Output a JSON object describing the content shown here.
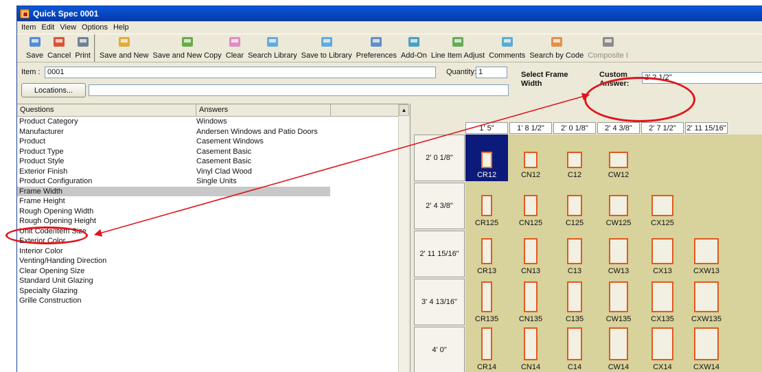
{
  "window": {
    "title": "Quick Spec 0001"
  },
  "menu": [
    "Item",
    "Edit",
    "View",
    "Options",
    "Help"
  ],
  "toolbar": {
    "group1": [
      {
        "label": "Save",
        "icon": "save-icon"
      },
      {
        "label": "Cancel",
        "icon": "cancel-icon"
      },
      {
        "label": "Print",
        "icon": "print-icon"
      }
    ],
    "group2": [
      {
        "label": "Save and New",
        "icon": "save-and-new-icon"
      },
      {
        "label": "Save and New Copy",
        "icon": "save-and-new-copy-icon"
      },
      {
        "label": "Clear",
        "icon": "clear-icon"
      },
      {
        "label": "Search Library",
        "icon": "search-library-icon"
      },
      {
        "label": "Save to Library",
        "icon": "save-to-library-icon"
      },
      {
        "label": "Preferences",
        "icon": "preferences-icon"
      },
      {
        "label": "Add-On",
        "icon": "add-on-icon"
      },
      {
        "label": "Line Item Adjust",
        "icon": "line-item-adjust-icon"
      },
      {
        "label": "Comments",
        "icon": "comments-icon"
      },
      {
        "label": "Search by Code",
        "icon": "search-by-code-icon"
      },
      {
        "label": "Composite I",
        "icon": "composite-icon",
        "disabled": true
      }
    ]
  },
  "item": {
    "label": "Item :",
    "value": "0001",
    "quantity_label": "Quantity:",
    "quantity_value": "1",
    "locations_button": "Locations...",
    "locations_value": ""
  },
  "select_frame": {
    "label_line1": "Select Frame",
    "label_line2": "Width",
    "custom_label_line1": "Custom",
    "custom_label_line2": "Answer:",
    "custom_value": "2' 2 1/2\""
  },
  "questions": {
    "header_question": "Questions",
    "header_answer": "Answers",
    "rows": [
      {
        "q": "Product Category",
        "a": "Windows"
      },
      {
        "q": "Manufacturer",
        "a": "Andersen Windows and Patio Doors"
      },
      {
        "q": "Product",
        "a": "Casement Windows"
      },
      {
        "q": "Product Type",
        "a": "Casement Basic"
      },
      {
        "q": "Product Style",
        "a": "Casement Basic"
      },
      {
        "q": "Exterior Finish",
        "a": "Vinyl Clad Wood"
      },
      {
        "q": "Product Configuration",
        "a": "Single Units"
      },
      {
        "q": "Frame Width",
        "a": "",
        "selected": true
      },
      {
        "q": "Frame Height",
        "a": ""
      },
      {
        "q": "Rough Opening Width",
        "a": ""
      },
      {
        "q": "Rough Opening Height",
        "a": ""
      },
      {
        "q": "Unit Code/Item Size",
        "a": ""
      },
      {
        "q": "Exterior Color",
        "a": ""
      },
      {
        "q": "Interior Color",
        "a": ""
      },
      {
        "q": "Venting/Handing Direction",
        "a": ""
      },
      {
        "q": "Clear Opening Size",
        "a": ""
      },
      {
        "q": "Standard Unit Glazing",
        "a": ""
      },
      {
        "q": "Specialty Glazing",
        "a": ""
      },
      {
        "q": "Grille Construction",
        "a": ""
      }
    ]
  },
  "size_grid": {
    "columns": [
      "1' 5\"",
      "1' 8 1/2\"",
      "2' 0 1/8\"",
      "2' 4 3/8\"",
      "2' 7 1/2\"",
      "2' 11 15/16\""
    ],
    "rows": [
      {
        "label": "2' 0 1/8\"",
        "cells": [
          "CR12",
          "CN12",
          "C12",
          "CW12",
          "",
          ""
        ]
      },
      {
        "label": "2' 4 3/8\"",
        "cells": [
          "CR125",
          "CN125",
          "C125",
          "CW125",
          "CX125",
          ""
        ]
      },
      {
        "label": "2' 11 15/16\"",
        "cells": [
          "CR13",
          "CN13",
          "C13",
          "CW13",
          "CX13",
          "CXW13"
        ]
      },
      {
        "label": "3' 4 13/16\"",
        "cells": [
          "CR135",
          "CN135",
          "C135",
          "CW135",
          "CX135",
          "CXW135"
        ]
      },
      {
        "label": "4' 0\"",
        "cells": [
          "CR14",
          "CN14",
          "C14",
          "CW14",
          "CX14",
          "CXW14"
        ]
      }
    ],
    "selected": "CR12"
  },
  "colors": {
    "titlebar": "#0846c0",
    "grid_background": "#d8d29c",
    "selected_cell": "#0c1a7a",
    "window_outline": "#e05a1e",
    "callout": "#e0151c"
  }
}
